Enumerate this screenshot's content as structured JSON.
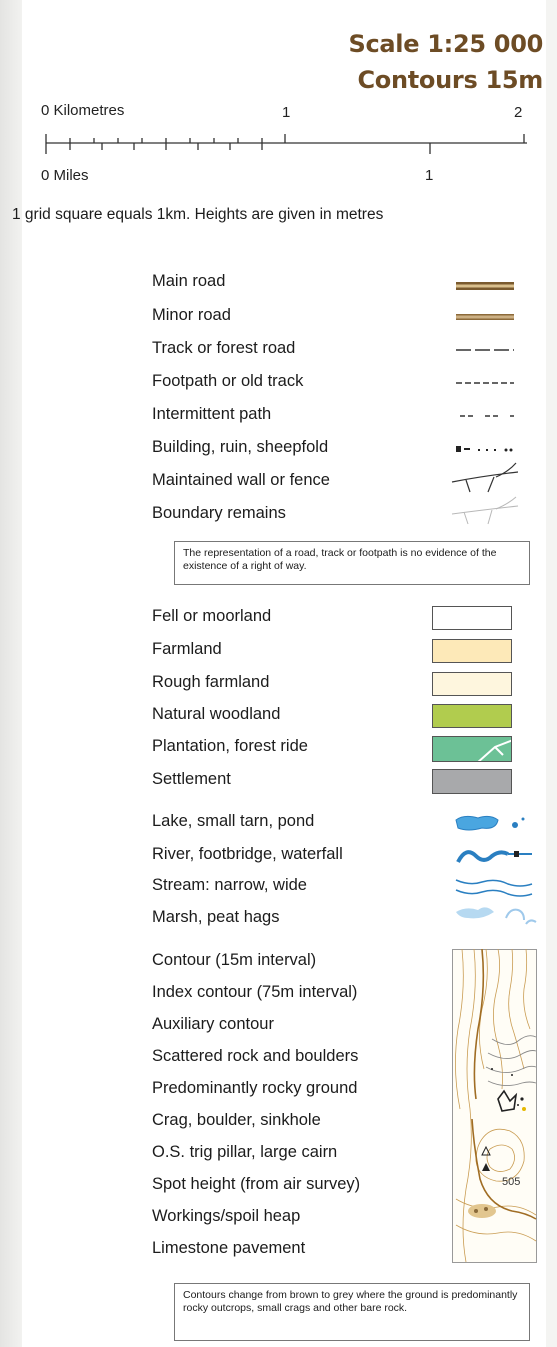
{
  "header": {
    "scale": "Scale 1:25 000",
    "contours": "Contours 15m"
  },
  "scale_bar": {
    "km_label": "0 Kilometres",
    "km_mid": "1",
    "km_end": "2",
    "miles_label": "0 Miles",
    "miles_mid": "1"
  },
  "grid_note": "1 grid square equals 1km. Heights are given in metres",
  "routes": [
    {
      "label": "Main road",
      "icon": "main-road-icon"
    },
    {
      "label": "Minor road",
      "icon": "minor-road-icon"
    },
    {
      "label": "Track or forest road",
      "icon": "track-icon"
    },
    {
      "label": "Footpath or old track",
      "icon": "footpath-icon"
    },
    {
      "label": "Intermittent path",
      "icon": "intermittent-path-icon"
    },
    {
      "label": "Building, ruin, sheepfold",
      "icon": "building-icon"
    },
    {
      "label": "Maintained wall or fence",
      "icon": "wall-icon"
    },
    {
      "label": "Boundary remains",
      "icon": "boundary-icon"
    }
  ],
  "right_of_way_note": "The representation of a road, track or footpath is no evidence of the existence of a right of way.",
  "land": [
    {
      "label": "Fell or moorland",
      "color": "#ffffff"
    },
    {
      "label": "Farmland",
      "color": "#fde9b8"
    },
    {
      "label": "Rough farmland",
      "color": "#fef6de"
    },
    {
      "label": "Natural woodland",
      "color": "#b1cc4e"
    },
    {
      "label": "Plantation, forest ride",
      "color": "#6cc196"
    },
    {
      "label": "Settlement",
      "color": "#a8a9ab"
    }
  ],
  "water": [
    {
      "label": "Lake, small tarn, pond",
      "icon": "lake-icon"
    },
    {
      "label": "River, footbridge, waterfall",
      "icon": "river-icon"
    },
    {
      "label": "Stream: narrow, wide",
      "icon": "stream-icon"
    },
    {
      "label": "Marsh, peat hags",
      "icon": "marsh-icon"
    }
  ],
  "relief": [
    "Contour (15m interval)",
    "Index contour (75m interval)",
    "Auxiliary contour",
    "Scattered rock and boulders",
    "Predominantly rocky ground",
    "Crag, boulder, sinkhole",
    "O.S. trig pillar, large cairn",
    "Spot height (from air survey)",
    "Workings/spoil heap",
    "Limestone pavement"
  ],
  "spot_height_value": "505",
  "contour_note": "Contours change from brown to grey where the ground is predominantly rocky outcrops, small crags and other bare rock.",
  "colors": {
    "title": "#6d4c25",
    "road_brown": "#7a5a2e",
    "road_tan": "#c8ab78",
    "water": "#2a7fc1",
    "water_light": "#8fc3ea",
    "contour_brown": "#b8893c",
    "contour_grey": "#8a8a8a"
  }
}
